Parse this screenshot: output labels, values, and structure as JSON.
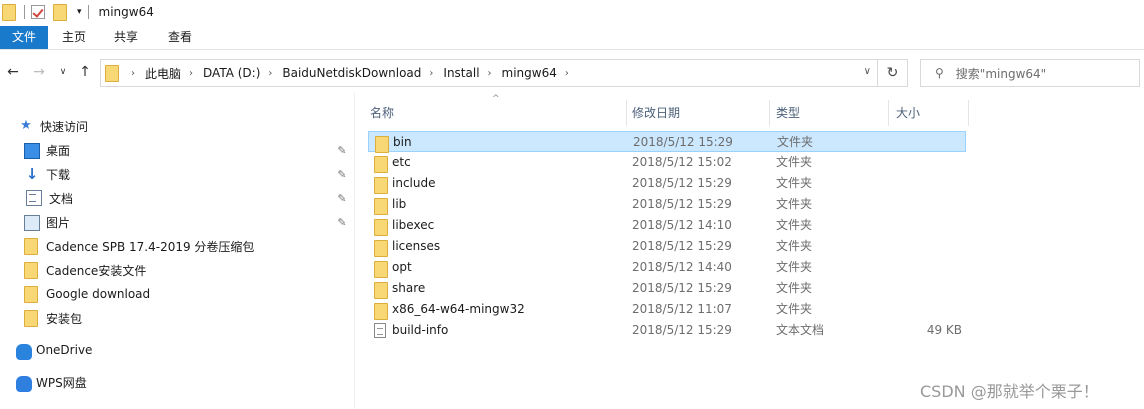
{
  "window": {
    "title": "mingw64"
  },
  "ribbon": {
    "tabs": [
      "文件",
      "主页",
      "共享",
      "查看"
    ]
  },
  "address": {
    "segments": [
      "此电脑",
      "DATA (D:)",
      "BaiduNetdiskDownload",
      "Install",
      "mingw64"
    ]
  },
  "search": {
    "placeholder": "搜索\"mingw64\""
  },
  "sidebar": {
    "quick_access": "快速访问",
    "items": [
      {
        "label": "桌面",
        "icon": "desktop-icon",
        "pinned": true
      },
      {
        "label": "下载",
        "icon": "download-icon",
        "pinned": true
      },
      {
        "label": "文档",
        "icon": "documents-icon",
        "pinned": true
      },
      {
        "label": "图片",
        "icon": "pictures-icon",
        "pinned": true
      },
      {
        "label": "Cadence SPB 17.4-2019 分卷压缩包",
        "icon": "folder-icon",
        "pinned": false
      },
      {
        "label": "Cadence安装文件",
        "icon": "folder-icon",
        "pinned": false
      },
      {
        "label": "Google download",
        "icon": "folder-icon",
        "pinned": false
      },
      {
        "label": "安装包",
        "icon": "folder-icon",
        "pinned": false
      }
    ],
    "onedrive": "OneDrive",
    "wps": "WPS网盘"
  },
  "columns": {
    "name": "名称",
    "date": "修改日期",
    "type": "类型",
    "size": "大小"
  },
  "files": [
    {
      "name": "bin",
      "date": "2018/5/12 15:29",
      "type": "文件夹",
      "size": "",
      "kind": "folder",
      "selected": true
    },
    {
      "name": "etc",
      "date": "2018/5/12 15:02",
      "type": "文件夹",
      "size": "",
      "kind": "folder"
    },
    {
      "name": "include",
      "date": "2018/5/12 15:29",
      "type": "文件夹",
      "size": "",
      "kind": "folder"
    },
    {
      "name": "lib",
      "date": "2018/5/12 15:29",
      "type": "文件夹",
      "size": "",
      "kind": "folder"
    },
    {
      "name": "libexec",
      "date": "2018/5/12 14:10",
      "type": "文件夹",
      "size": "",
      "kind": "folder"
    },
    {
      "name": "licenses",
      "date": "2018/5/12 15:29",
      "type": "文件夹",
      "size": "",
      "kind": "folder"
    },
    {
      "name": "opt",
      "date": "2018/5/12 14:40",
      "type": "文件夹",
      "size": "",
      "kind": "folder"
    },
    {
      "name": "share",
      "date": "2018/5/12 15:29",
      "type": "文件夹",
      "size": "",
      "kind": "folder"
    },
    {
      "name": "x86_64-w64-mingw32",
      "date": "2018/5/12 11:07",
      "type": "文件夹",
      "size": "",
      "kind": "folder"
    },
    {
      "name": "build-info",
      "date": "2018/5/12 15:29",
      "type": "文本文档",
      "size": "49 KB",
      "kind": "file"
    }
  ],
  "watermark": "CSDN @那就举个栗子！",
  "colors": {
    "accent": "#1979ca",
    "selection": "#cce8ff",
    "folder": "#f8d775"
  }
}
